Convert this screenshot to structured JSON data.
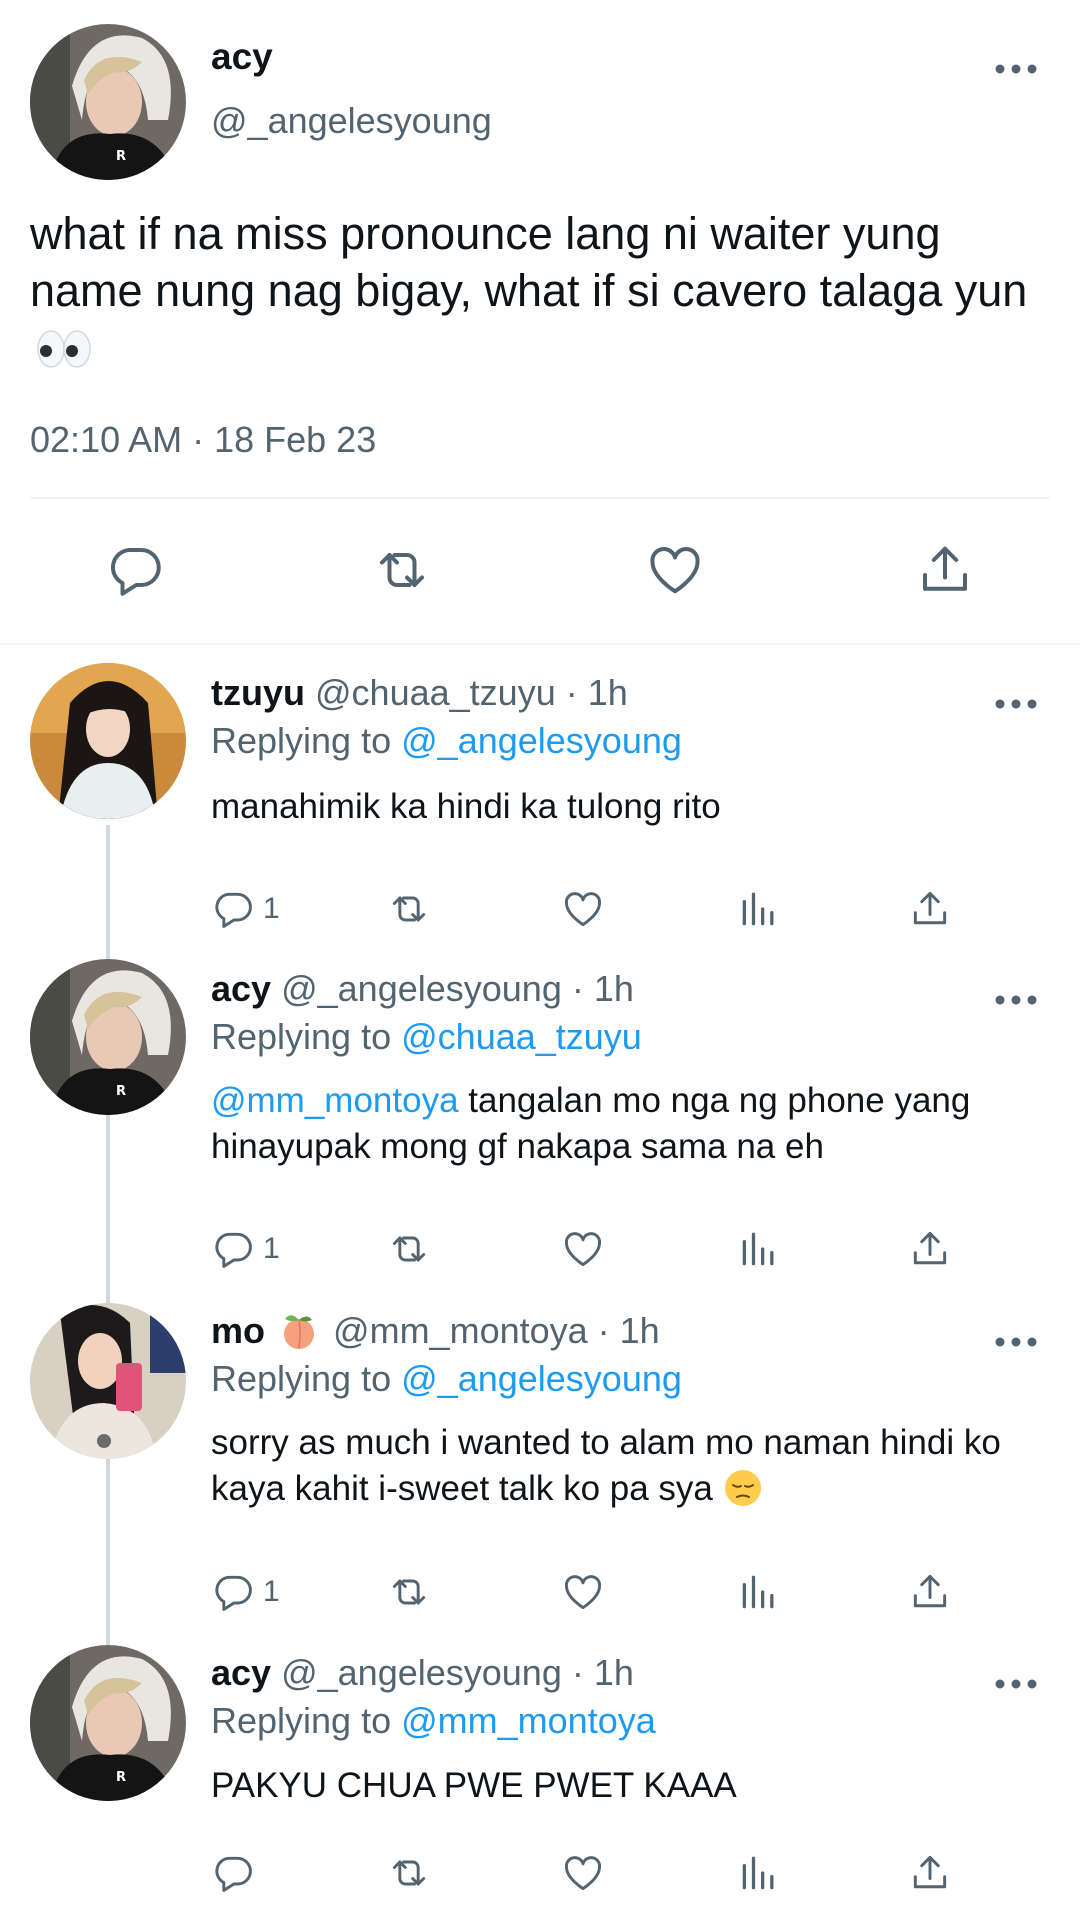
{
  "main_tweet": {
    "name": "acy",
    "handle": "@_angelesyoung",
    "text": "what if na miss pronounce lang ni waiter yung name nung nag bigay, what if si cavero talaga yun",
    "timestamp": "02:10 AM · 18 Feb 23",
    "actions": [
      "reply-icon",
      "retweet-icon",
      "like-icon",
      "share-icon"
    ]
  },
  "replies": [
    {
      "name": "tzuyu",
      "handle_time": "@chuaa_tzuyu · 1h",
      "replying_prefix": "Replying to",
      "replying_to": "@_angelesyoung",
      "text": "manahimik ka hindi ka tulong rito",
      "reply_count": "1"
    },
    {
      "name": "acy",
      "handle_time": "@_angelesyoung · 1h",
      "replying_prefix": "Replying to",
      "replying_to": "@chuaa_tzuyu",
      "mention": "@mm_montoya",
      "text": " tangalan mo nga ng phone yang hinayupak mong gf nakapa sama na eh",
      "reply_count": "1"
    },
    {
      "name": "mo",
      "handle_time": "@mm_montoya · 1h",
      "replying_prefix": "Replying to",
      "replying_to": "@_angelesyoung",
      "text": "sorry as much i wanted to alam mo naman hindi ko kaya kahit i-sweet talk ko pa sya",
      "reply_count": "1"
    },
    {
      "name": "acy",
      "handle_time": "@_angelesyoung · 1h",
      "replying_prefix": "Replying to",
      "replying_to": "@mm_montoya",
      "text": "PAKYU CHUA PWE PWET KAAA",
      "reply_count": ""
    }
  ],
  "colors": {
    "link": "#1d9bf0",
    "secondary_text": "#536471",
    "icon": "#536471",
    "divider": "#eff3f4",
    "thread_line": "#cfd9de"
  }
}
